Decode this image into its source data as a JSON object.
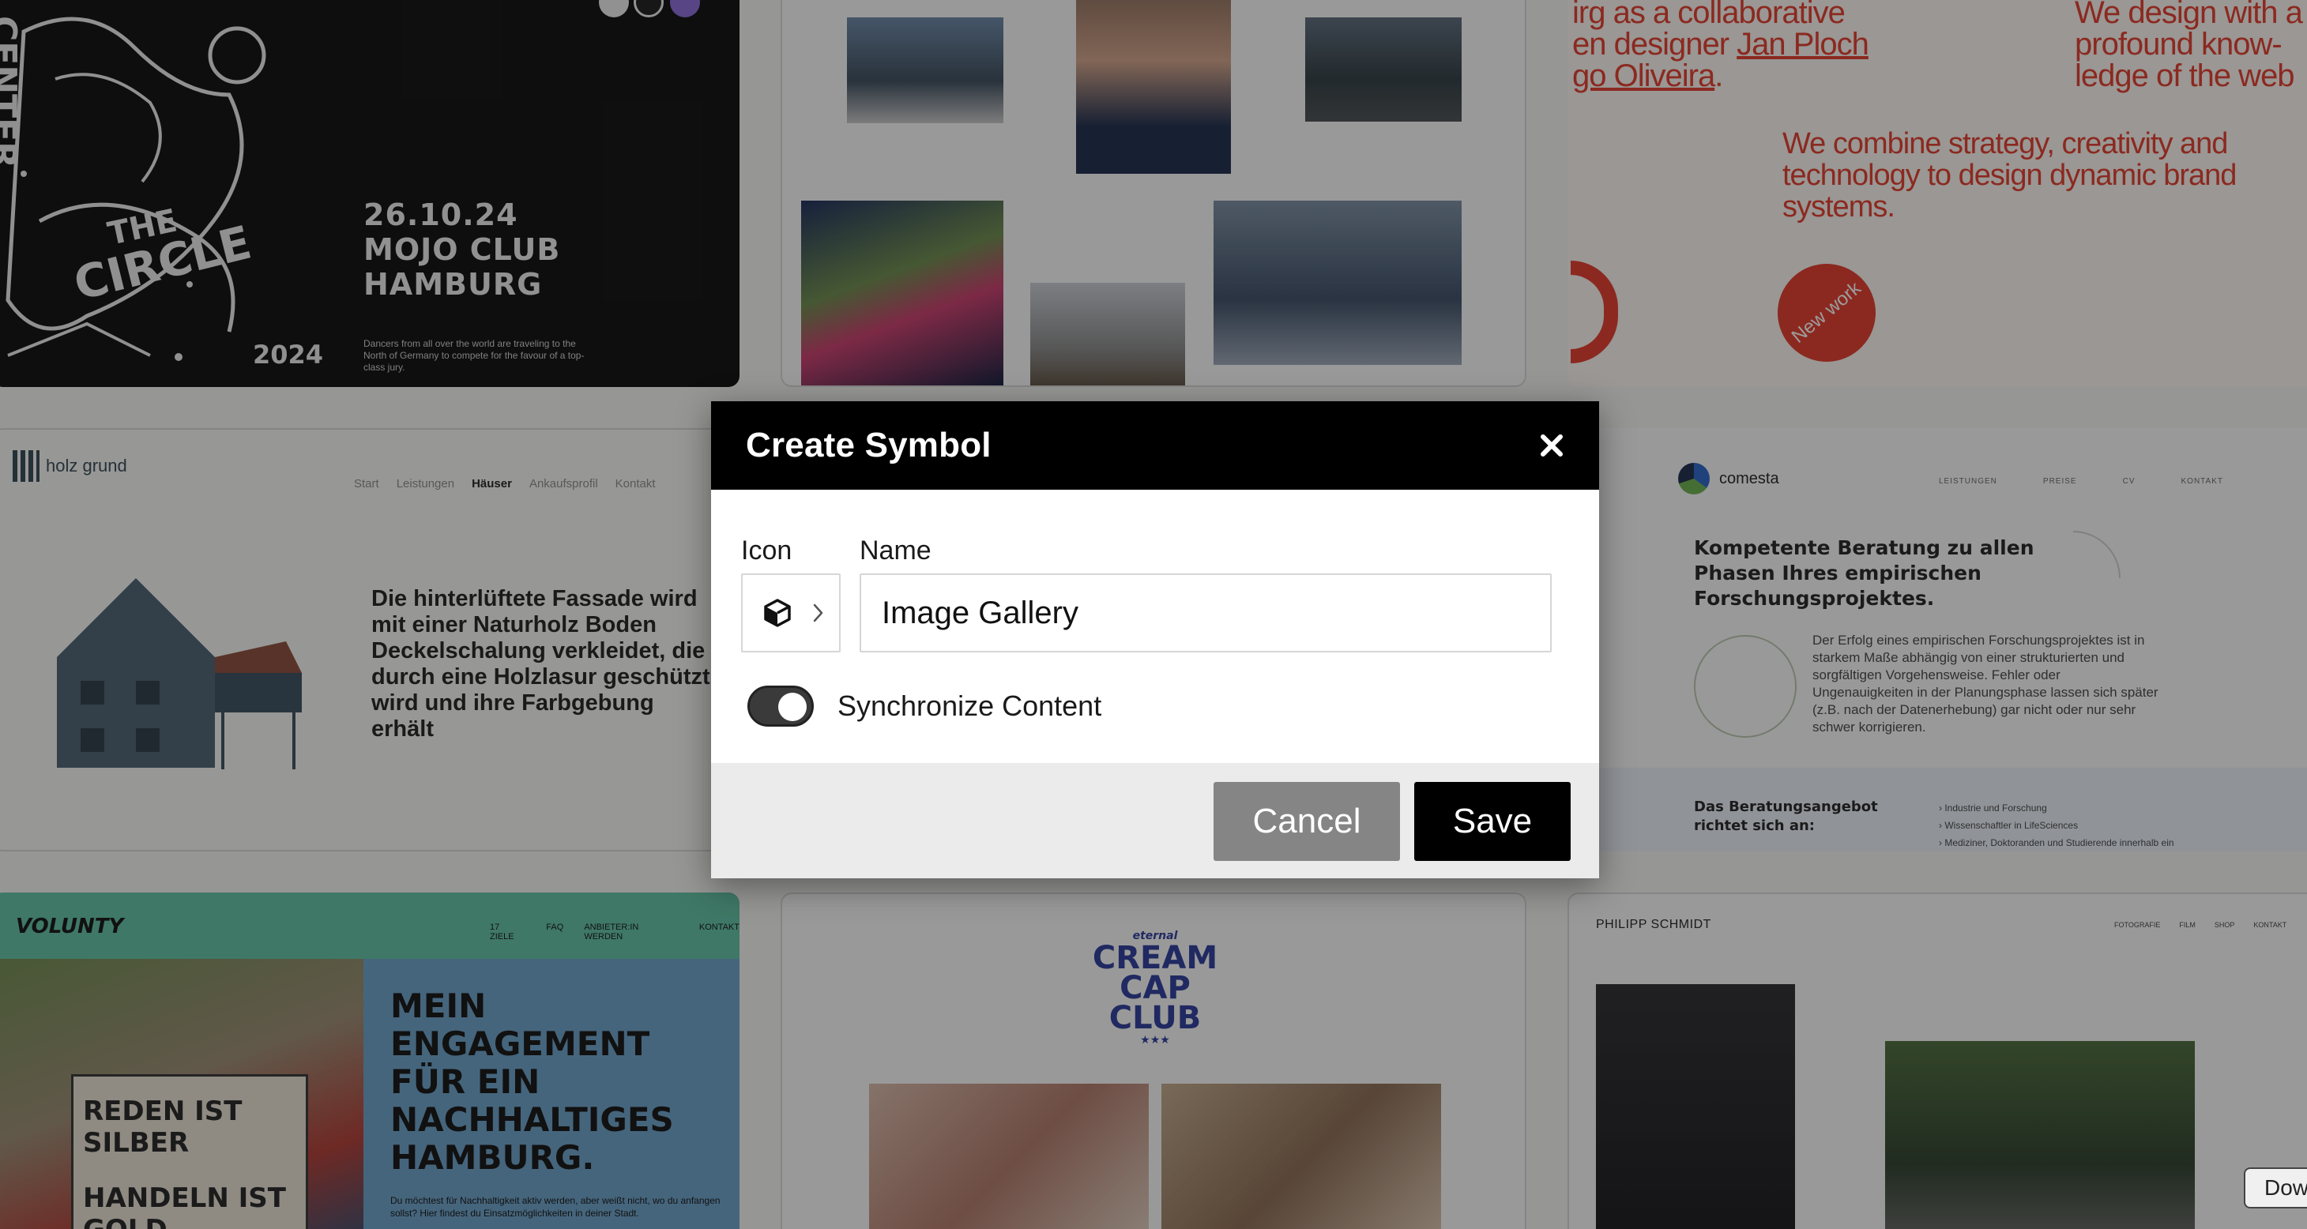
{
  "background": {
    "event_tile": {
      "date_lines": [
        "26.10.24",
        "MOJO CLUB",
        "HAMBURG"
      ],
      "blurb": "Dancers from all over the world are traveling to the North of Germany to compete for the favour of a top-class jury.",
      "art_lettering": [
        "CENTER",
        "THE",
        "CIRCLE",
        "2024"
      ]
    },
    "studio_tile": {
      "line1a": "irg as a collaborative",
      "line1b_prefix": "en designer ",
      "line1b_link": "Jan Ploch",
      "line1c": "go Oliveira",
      "line1c_suffix": ".",
      "right_text": "We design with a profound know-ledge of the web",
      "main_text": "We combine strategy, creativity and technology to design dynamic brand systems.",
      "badge": "New work"
    },
    "holz_tile": {
      "logo": "holz grund",
      "nav": [
        "Start",
        "Leistungen",
        "Häuser",
        "Ankaufsprofil",
        "Kontakt"
      ],
      "active_nav": "Häuser",
      "text": "Die hinterlüftete Fassade wird mit einer Naturholz Boden Deckelschalung verkleidet, die durch eine Holzlasur geschützt wird und ihre Farbgebung erhält"
    },
    "comesta_tile": {
      "logo": "comesta",
      "nav": [
        "LEISTUNGEN",
        "PREISE",
        "CV",
        "KONTAKT"
      ],
      "headline": "Kompetente Beratung zu allen Phasen Ihres empirischen Forschungsprojektes.",
      "body": "Der Erfolg eines empirischen Forschungsprojektes ist in starkem Maße abhängig von einer strukturierten und sorgfältigen Vorgehensweise. Fehler oder Ungenauigkeiten in der Planungsphase lassen sich später (z.B. nach der Datenerhebung) gar nicht oder nur sehr schwer korrigieren.",
      "subhead": "Das Beratungsangebot richtet sich an:",
      "list": [
        "› Industrie und Forschung",
        "› Wissenschaftler in LifeSciences",
        "› Mediziner, Doktoranden und Studierende innerhalb ein"
      ]
    },
    "volunty_tile": {
      "logo": "VOLUNTY",
      "nav": [
        "17 ZIELE",
        "FAQ",
        "ANBIETER:IN WERDEN",
        "KONTAKT"
      ],
      "sign_lines": [
        "REDEN IST SILBER",
        "HANDELN IST GOLD"
      ],
      "headline": "MEIN ENGAGEMENT FÜR EIN NACHHALTIGES HAMBURG.",
      "body": "Du möchtest für Nachhaltigkeit aktiv werden, aber weißt nicht, wo du anfangen sollst? Hier findest du Einsatzmöglichkeiten in deiner Stadt."
    },
    "cream_tile": {
      "small": "eternal",
      "logo": "CREAM CAP CLUB",
      "stars": "★★★"
    },
    "photo_tile": {
      "name": "PHILIPP SCHMIDT",
      "nav": [
        "FOTOGRAFIE",
        "FILM",
        "SHOP",
        "KONTAKT"
      ]
    },
    "corner_button": "Dow"
  },
  "modal": {
    "title": "Create Symbol",
    "close_glyph": "✖",
    "icon_label": "Icon",
    "name_label": "Name",
    "selected_icon": "cube-icon",
    "chevron": "›",
    "name_value": "Image Gallery",
    "sync_label": "Synchronize Content",
    "sync_enabled": true,
    "cancel_label": "Cancel",
    "save_label": "Save"
  },
  "colors": {
    "accent_red": "#e23a2a",
    "modal_header": "#000000",
    "cancel_bg": "#858585",
    "save_bg": "#000000"
  }
}
